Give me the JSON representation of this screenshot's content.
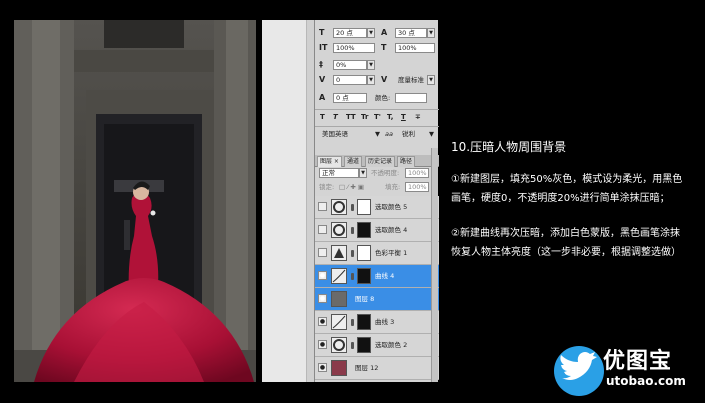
{
  "char_panel": {
    "font_size": "20 点",
    "leading": "30 点",
    "vscale": "100%",
    "hscale": "100%",
    "tracking_pct": "0%",
    "kerning": "0",
    "kerning_mode": "度量标准",
    "baseline": "0 点",
    "color_label": "颜色:",
    "style_glyphs": [
      "T",
      "T",
      "TT",
      "Tr",
      "T'",
      "T,",
      "T",
      "∓"
    ],
    "language": "美国英语",
    "aa_label": "aa",
    "aa_mode": "锐利"
  },
  "layers_panel": {
    "tabs": [
      "图层 ×",
      "通道",
      "历史记录",
      "路径"
    ],
    "blend_mode": "正常",
    "opacity_label": "不透明度:",
    "opacity": "100%",
    "lock_label": "锁定:",
    "fill_label": "填充:",
    "fill": "100%",
    "layers": [
      {
        "name": "选取颜色 5",
        "visible": false,
        "selected": false
      },
      {
        "name": "选取颜色 4",
        "visible": false,
        "selected": false
      },
      {
        "name": "色彩平衡 1",
        "visible": false,
        "selected": false
      },
      {
        "name": "曲线 4",
        "visible": true,
        "selected": true
      },
      {
        "name": "图层 8",
        "visible": true,
        "selected": true
      },
      {
        "name": "曲线 3",
        "visible": true,
        "selected": false
      },
      {
        "name": "选取颜色 2",
        "visible": true,
        "selected": false
      },
      {
        "name": "图层 12",
        "visible": true,
        "selected": false
      }
    ]
  },
  "tutorial": {
    "title": "10.压暗人物周围背景",
    "para1": [
      "①新建图层，填充50%灰色，模式设为柔光，用黑色",
      "画笔，硬度0，不透明度20%进行简单涂抹压暗；"
    ],
    "para2": [
      "②新建曲线再次压暗，添加白色蒙版，黑色画笔涂抹",
      "恢复人物主体亮度（这一步非必要，根据调整选做）"
    ]
  },
  "logo": {
    "name": "优图宝",
    "url": "utobao.com"
  },
  "colors": {
    "selected_layer": "#3a8ee6",
    "dress": "#b5123a",
    "logo_blue": "#2aa0e6"
  }
}
